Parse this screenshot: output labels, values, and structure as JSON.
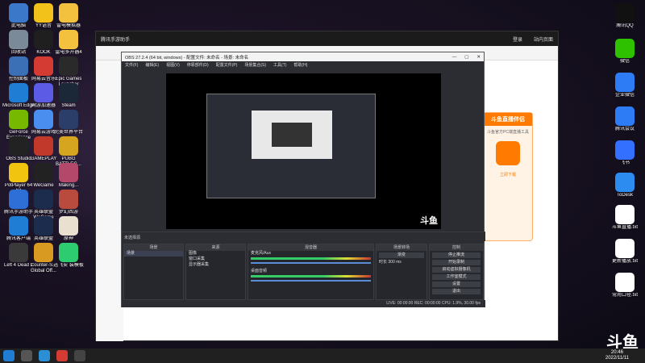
{
  "left_icons": [
    {
      "label": "此电脑",
      "color": "#3b78c9"
    },
    {
      "label": "YY语音",
      "color": "#f2c21b"
    },
    {
      "label": "雷电模拟器",
      "color": "#f3c13d"
    },
    {
      "label": "回收站",
      "color": "#7b8a99"
    },
    {
      "label": "KOOK",
      "color": "#1f1f1f"
    },
    {
      "label": "雷电多开器4",
      "color": "#f3c13d"
    },
    {
      "label": "控制面板",
      "color": "#3b6fb6"
    },
    {
      "label": "网易云音乐",
      "color": "#d43c33"
    },
    {
      "label": "Epic Games Launcher",
      "color": "#2a2a2a"
    },
    {
      "label": "Microsoft Edge",
      "color": "#1f7ed3"
    },
    {
      "label": "网游加速器",
      "color": "#5b5be6"
    },
    {
      "label": "Steam",
      "color": "#1b2838"
    },
    {
      "label": "GeForce Experience",
      "color": "#76b900"
    },
    {
      "label": "网易云游戏",
      "color": "#4a8ef0"
    },
    {
      "label": "完美世界平台",
      "color": "#2b3e6a"
    },
    {
      "label": "OBS Studio",
      "color": "#222"
    },
    {
      "label": "GAMEPLAY",
      "color": "#c0392b"
    },
    {
      "label": "PUBG BATTLEG...",
      "color": "#d6a520"
    },
    {
      "label": "PotPlayer 64 bit",
      "color": "#f1c40f"
    },
    {
      "label": "WeGame",
      "color": "#222"
    },
    {
      "label": "Making...",
      "color": "#b3486b"
    },
    {
      "label": "腾讯手游助手",
      "color": "#2d6fd6"
    },
    {
      "label": "英雄联盟 WeGame",
      "color": "#1c2c4c"
    },
    {
      "label": "梦幻西游",
      "color": "#b84a3e"
    },
    {
      "label": "腾讯客户端",
      "color": "#1f7ed3"
    },
    {
      "label": "英雄联盟",
      "color": "#1c2c4c"
    },
    {
      "label": "原神",
      "color": "#e9e0d0"
    },
    {
      "label": "Left 4 Dead 2",
      "color": "#3a3a3a"
    },
    {
      "label": "Counter-S... Global Off...",
      "color": "#d99a21"
    },
    {
      "label": "迅飞安 装模板",
      "color": "#2ecc71"
    }
  ],
  "right_icons": [
    {
      "label": "腾讯QQ",
      "color": "#111"
    },
    {
      "label": "微信",
      "color": "#2dc100"
    },
    {
      "label": "企业微信",
      "color": "#2d7cf6"
    },
    {
      "label": "腾讯会议",
      "color": "#2d7cf6"
    },
    {
      "label": "飞书",
      "color": "#3370ff"
    },
    {
      "label": "ToDesk",
      "color": "#2d8cf0"
    },
    {
      "label": "斗鱼直播.txt",
      "color": "#ffffff"
    },
    {
      "label": "更新播放.txt",
      "color": "#ffffff"
    },
    {
      "label": "常用口径.txt",
      "color": "#ffffff"
    }
  ],
  "browser": {
    "title": "腾讯手游助手",
    "tabs": [
      "推荐",
      "游戏",
      "小说",
      "直播",
      "小说",
      "热门"
    ],
    "right_btn": "登录",
    "right_text": "站内页面"
  },
  "obs": {
    "title": "OBS 27.2.4 (64 bit, windows) - 配置文件: 未命名 - 场景: 未命名",
    "menu": [
      "文件(F)",
      "编辑(E)",
      "视图(V)",
      "停靠部件(D)",
      "配置文件(P)",
      "场景集合(S)",
      "工具(T)",
      "帮助(H)"
    ],
    "no_source": "未选择源",
    "scene_header": "场景",
    "scene_item": "场景",
    "source_header": "来源",
    "sources": [
      "图像",
      "窗口采集",
      "显示器采集"
    ],
    "mixer_header": "混音器",
    "mixer": [
      {
        "name": "麦克风/Aux",
        "db": "0.0 dB"
      },
      {
        "name": "桌面音频",
        "db": "0.0 dB"
      }
    ],
    "trans_header": "场景转场",
    "trans_type": "渐变",
    "trans_dur_label": "时长",
    "trans_dur": "300 ms",
    "ctrl_header": "控制",
    "controls": [
      "停止推流",
      "开始录制",
      "启动虚拟摄像机",
      "工作室模式",
      "设置",
      "退出"
    ],
    "status": "LIVE: 00:00:00   REC: 00:00:00   CPU: 1.9%, 30.00 fps"
  },
  "douyu": {
    "brand": "斗鱼",
    "banner": "斗鱼直播伴侣",
    "sub": "斗鱼官方PC端直播工具",
    "btn": "立即下载"
  },
  "clock": {
    "time": "20:46",
    "date": "2022/11/11"
  }
}
